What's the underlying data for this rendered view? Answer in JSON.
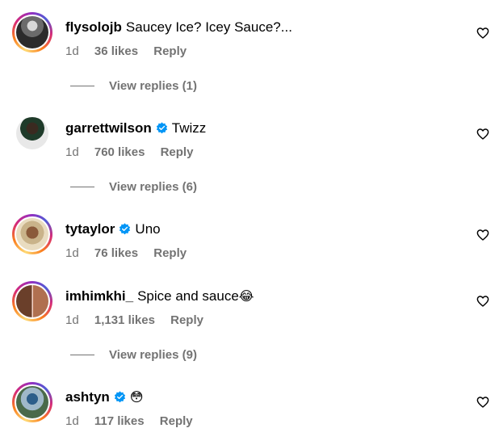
{
  "comments": [
    {
      "username": "flysolojb",
      "verified": false,
      "text": "Saucey Ice? Icey Sauce?...",
      "time": "1d",
      "likes": "36 likes",
      "reply_label": "Reply",
      "view_replies": "View replies (1)"
    },
    {
      "username": "garrettwilson",
      "verified": true,
      "text": "Twizz",
      "time": "1d",
      "likes": "760 likes",
      "reply_label": "Reply",
      "view_replies": "View replies (6)"
    },
    {
      "username": "tytaylor",
      "verified": true,
      "text": "Uno",
      "time": "1d",
      "likes": "76 likes",
      "reply_label": "Reply"
    },
    {
      "username": "imhimkhi_",
      "verified": false,
      "text": "Spice and sauce",
      "emoji": "😂",
      "time": "1d",
      "likes": "1,131 likes",
      "reply_label": "Reply",
      "view_replies": "View replies (9)"
    },
    {
      "username": "ashtyn",
      "verified": true,
      "text": "😳",
      "time": "1d",
      "likes": "117 likes",
      "reply_label": "Reply"
    }
  ],
  "colors": {
    "verified_badge": "#0095f6",
    "secondary_text": "#737373"
  }
}
